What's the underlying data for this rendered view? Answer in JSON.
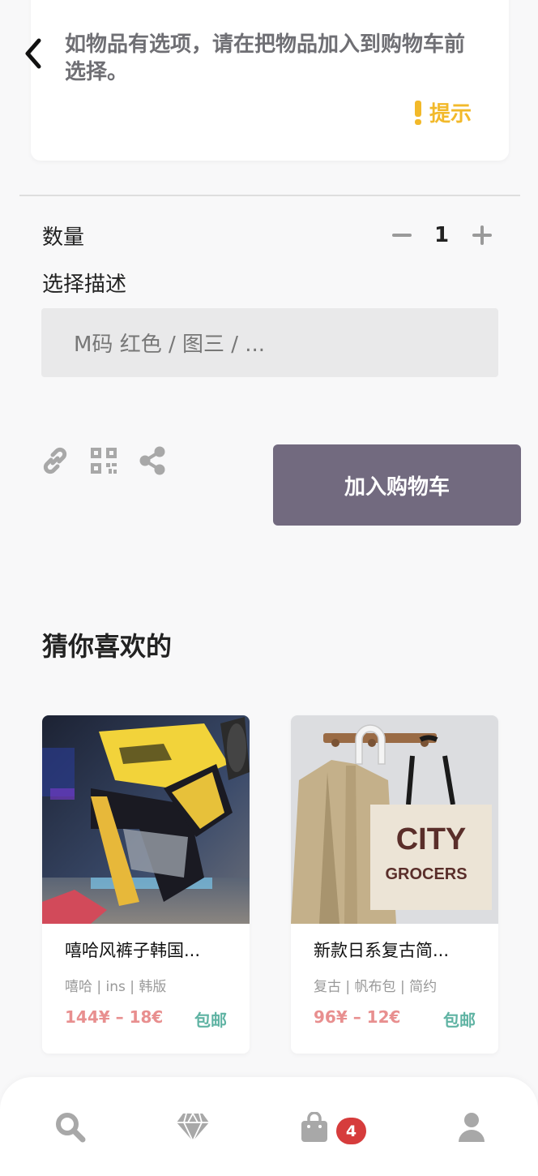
{
  "tip": {
    "text": "如物品有选项，请在把物品加入到购物车前选择。",
    "hint_label": "提示",
    "hint_color": "#f2b92a"
  },
  "options": {
    "quantity_label": "数量",
    "quantity_value": "1",
    "description_label": "选择描述",
    "description_value": "M码 红色 / 图三 / ..."
  },
  "actions": {
    "share_icons": [
      "link-icon",
      "qr-code-icon",
      "share-icon"
    ],
    "add_to_cart_label": "加入购物车",
    "add_to_cart_color": "#726a7f"
  },
  "recommendations": {
    "title": "猜你喜欢的",
    "products": [
      {
        "name": "嘻哈风裤子韩国...",
        "tags": "嘻哈 | ins | 韩版",
        "price": "144¥ – 18€",
        "shipping": "包邮"
      },
      {
        "name": "新款日系复古简...",
        "tags": "复古 | 帆布包 | 简约",
        "price": "96¥ – 12€",
        "shipping": "包邮"
      }
    ],
    "tote_print": "CITY GROCERS"
  },
  "bottom_nav": {
    "items": [
      "search-icon",
      "diamond-icon",
      "shopping-bag-icon",
      "user-icon"
    ],
    "cart_badge": "4"
  },
  "colors": {
    "price": "#e88f8f",
    "shipping": "#5fb3a3",
    "badge": "#d63c3c"
  }
}
